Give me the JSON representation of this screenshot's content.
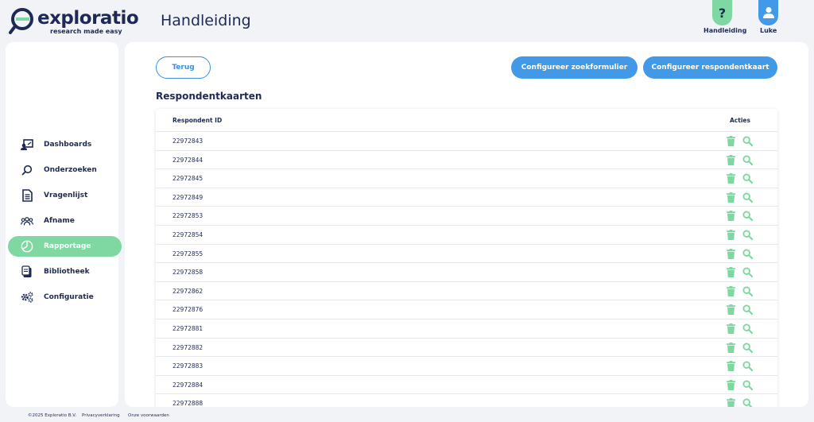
{
  "brand": {
    "name": "exploratio",
    "tagline": "research made easy"
  },
  "header": {
    "title": "Handleiding",
    "help_tab": {
      "label": "Handleiding",
      "icon": "question-icon"
    },
    "user_tab": {
      "label": "Luke",
      "icon": "user-icon"
    }
  },
  "sidebar": {
    "items": [
      {
        "label": "Dashboards",
        "icon": "dashboard-icon",
        "active": false
      },
      {
        "label": "Onderzoeken",
        "icon": "search-icon",
        "active": false
      },
      {
        "label": "Vragenlijst",
        "icon": "document-icon",
        "active": false
      },
      {
        "label": "Afname",
        "icon": "people-icon",
        "active": false
      },
      {
        "label": "Rapportage",
        "icon": "pie-chart-icon",
        "active": true
      },
      {
        "label": "Bibliotheek",
        "icon": "library-icon",
        "active": false
      },
      {
        "label": "Configuratie",
        "icon": "gears-icon",
        "active": false
      }
    ]
  },
  "main": {
    "back_label": "Terug",
    "configure_search_label": "Configureer zoekformulier",
    "configure_card_label": "Configureer respondentkaart",
    "section_title": "Respondentkaarten",
    "table": {
      "col_id": "Respondent ID",
      "col_actions": "Acties",
      "rows": [
        "22972843",
        "22972844",
        "22972845",
        "22972849",
        "22972853",
        "22972854",
        "22972855",
        "22972858",
        "22972862",
        "22972876",
        "22972881",
        "22972882",
        "22972883",
        "22972884",
        "22972888"
      ]
    }
  },
  "footer": {
    "copyright": "©2025 Exploratio B.V.",
    "privacy": "Privacyverklaring",
    "terms": "Onze voorwaarden"
  },
  "colors": {
    "navy": "#1e2a55",
    "green": "#7fd8a1",
    "blue": "#4299e8",
    "background": "#f2f3f7"
  }
}
